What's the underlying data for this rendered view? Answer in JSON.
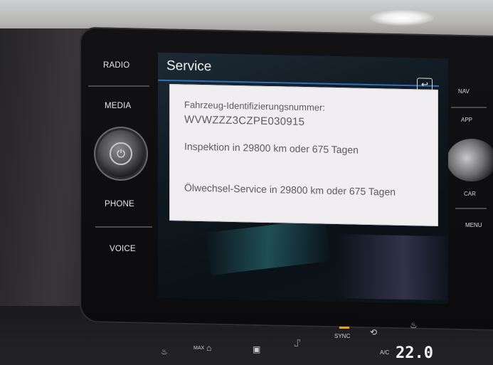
{
  "head_unit": {
    "left_buttons": [
      "RADIO",
      "MEDIA",
      "PHONE",
      "VOICE"
    ],
    "right_buttons": [
      "NAV",
      "APP",
      "CAR",
      "MENU"
    ]
  },
  "screen": {
    "title": "Service",
    "back_icon": "back-arrow-icon",
    "panel": {
      "vin_label": "Fahrzeug-Identifizierungsnummer:",
      "vin_value": "WVWZZZ3CZPE030915",
      "inspection": "Inspektion in 29800 km oder 675 Tagen",
      "oil_service": "Ölwechsel-Service in 29800 km oder 675 Tagen"
    },
    "accent_color": "#2f6fb8"
  },
  "climate": {
    "max_label": "MAX",
    "sync_label": "SYNC",
    "ac_label": "A/C",
    "temperature": "22.0"
  }
}
